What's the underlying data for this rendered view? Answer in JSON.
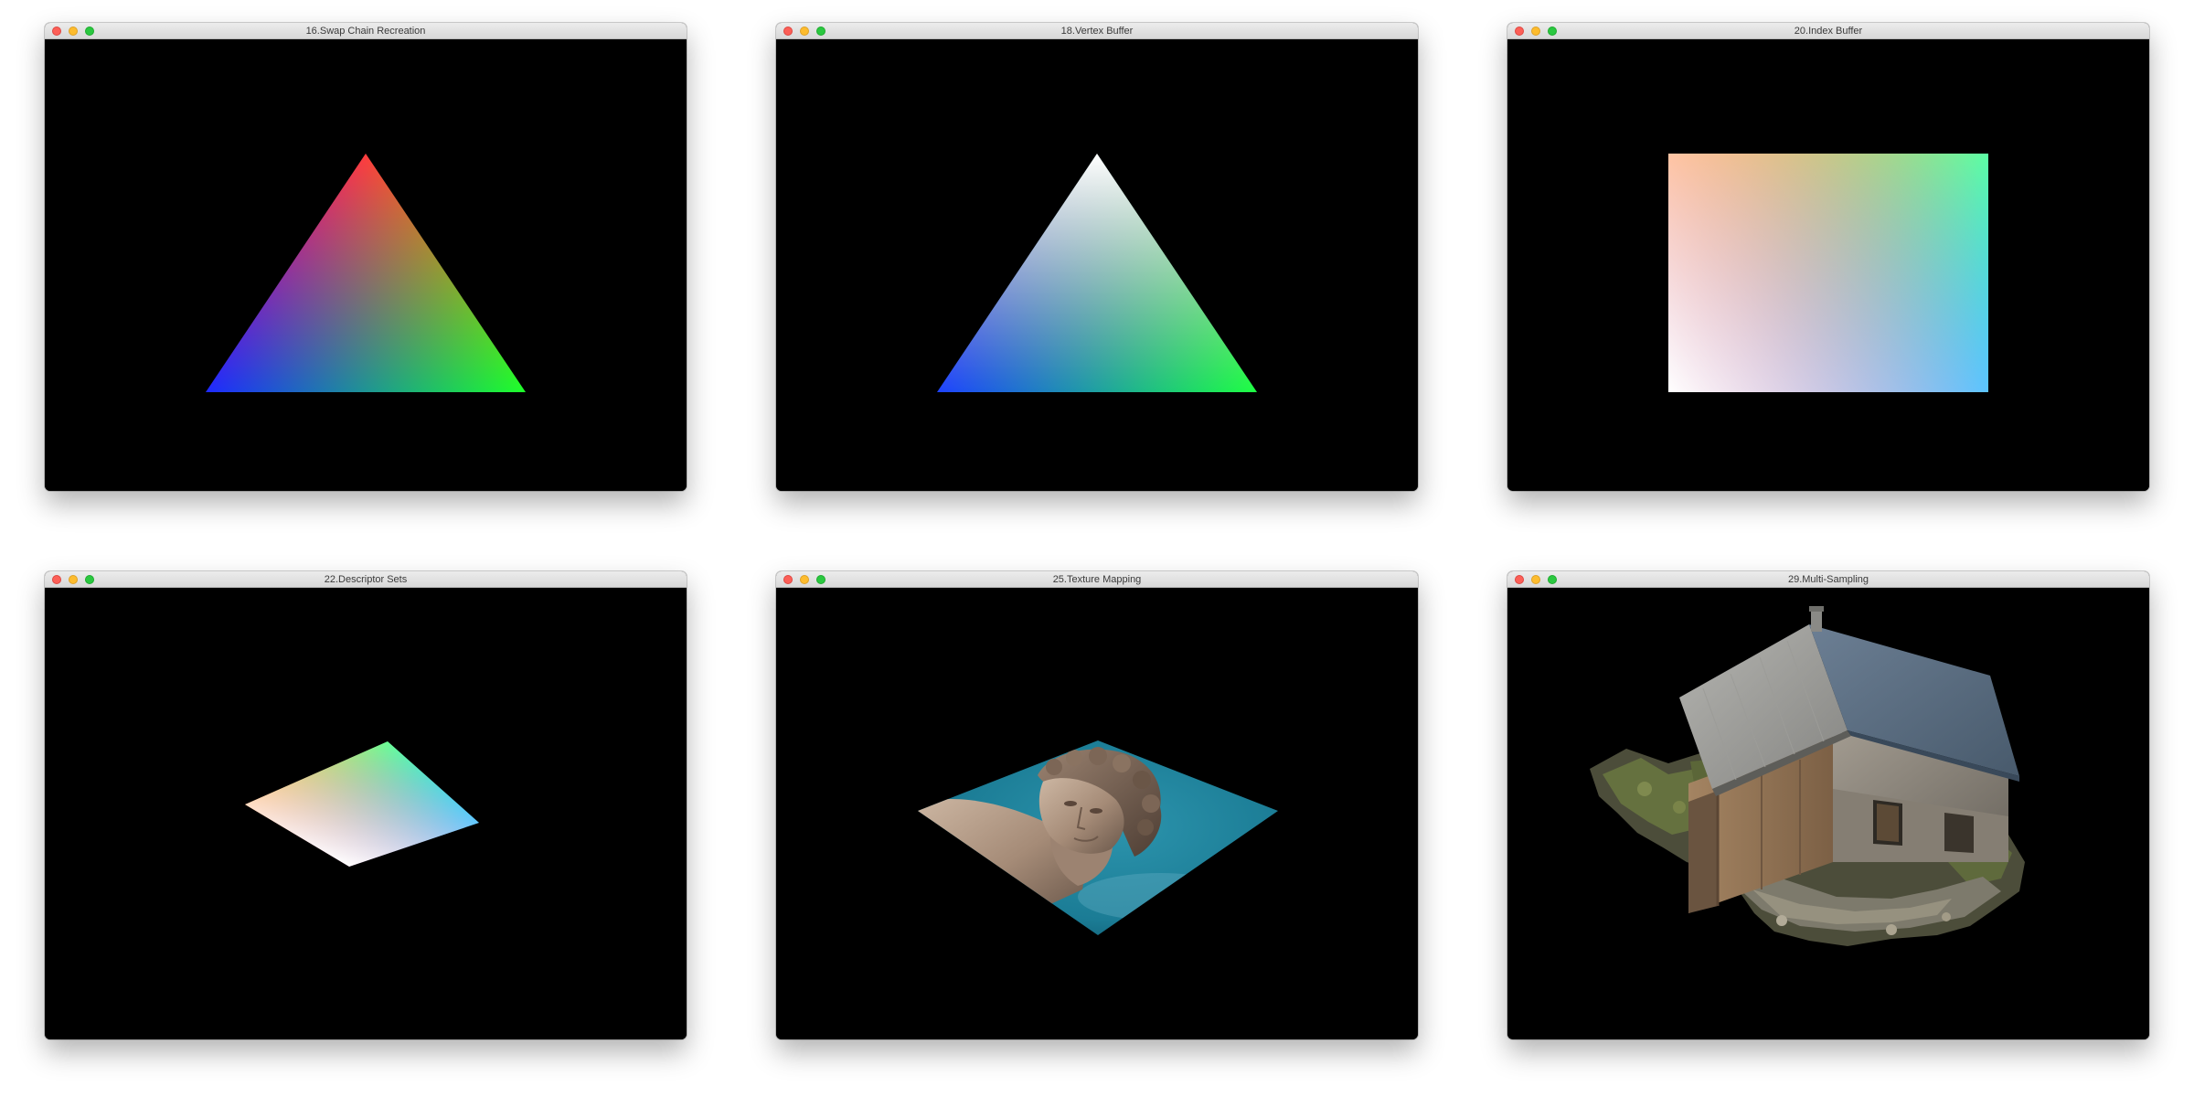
{
  "windows": [
    {
      "title": "16.Swap Chain Recreation",
      "render": "triangle-rgb"
    },
    {
      "title": "18.Vertex Buffer",
      "render": "triangle-white-blue-green"
    },
    {
      "title": "20.Index Buffer",
      "render": "rectangle-rgbw"
    },
    {
      "title": "22.Descriptor Sets",
      "render": "rotating-quad-rgbw"
    },
    {
      "title": "25.Texture Mapping",
      "render": "textured-quad-statue"
    },
    {
      "title": "29.Multi-Sampling",
      "render": "3d-model-house"
    }
  ],
  "traffic_lights": {
    "close": "#fc5f57",
    "minimize": "#fdbc2e",
    "zoom": "#2ac840"
  },
  "colors": {
    "titlebar": "#e2e2e2",
    "viewport": "#000000"
  }
}
